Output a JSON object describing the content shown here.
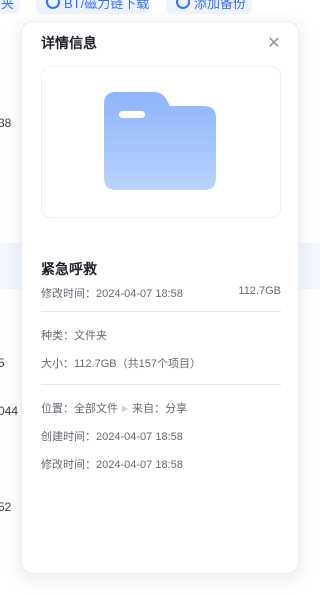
{
  "background": {
    "top_buttons": [
      {
        "label": "夹"
      },
      {
        "label": "BT/磁力链下载"
      },
      {
        "label": "添加备份"
      }
    ],
    "row_numbers": [
      "38",
      "5",
      "044",
      "52"
    ]
  },
  "panel": {
    "title": "详情信息",
    "file": {
      "name": "紧急呼救",
      "modified_label": "修改时间：2024-04-07 18:58",
      "size_short": "112.7GB"
    },
    "details": {
      "type": "种类：文件夹",
      "size": "大小：112.7GB（共157个项目）"
    },
    "location": {
      "prefix": "位置：",
      "path": "全部文件",
      "source_prefix": "来自：",
      "source": "分享"
    },
    "created": "创建时间：2024-04-07 18:58",
    "modified": "修改时间：2024-04-07 18:58"
  },
  "colors": {
    "accent": "#3370ff",
    "folder_top": "#8fb3fb",
    "folder_bottom": "#b9d3ff"
  },
  "icons": [
    "close-icon",
    "folder-icon",
    "chevron-right-icon",
    "link-icon",
    "backup-icon"
  ]
}
